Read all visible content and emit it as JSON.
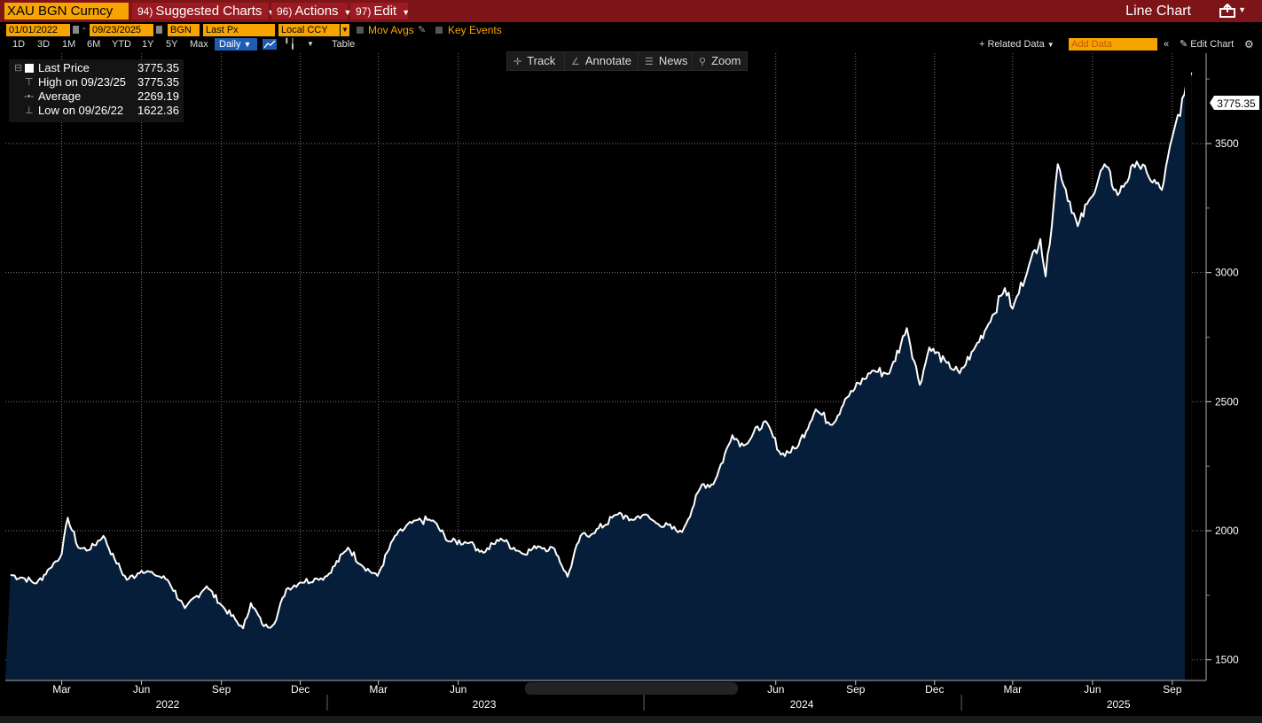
{
  "header": {
    "ticker": "XAU BGN Curncy",
    "menus": [
      {
        "num": "94)",
        "label": "Suggested Charts"
      },
      {
        "num": "96)",
        "label": "Actions"
      },
      {
        "num": "97)",
        "label": "Edit"
      }
    ],
    "chart_type_label": "Line Chart"
  },
  "controls": {
    "start_date": "01/01/2022",
    "end_date": "09/23/2025",
    "source": "BGN",
    "field": "Last Px",
    "currency": "Local CCY",
    "mov_avgs": "Mov Avgs",
    "key_events": "Key Events",
    "ranges": [
      "1D",
      "3D",
      "1M",
      "6M",
      "YTD",
      "1Y",
      "5Y",
      "Max"
    ],
    "frequency": "Daily",
    "table": "Table",
    "related_data": "+ Related Data",
    "add_data_placeholder": "Add Data",
    "edit_chart": "Edit Chart"
  },
  "toolbar": {
    "track": "Track",
    "annotate": "Annotate",
    "news": "News",
    "zoom": "Zoom"
  },
  "legend": {
    "rows": [
      {
        "label": "Last Price",
        "value": "3775.35"
      },
      {
        "label": "High on 09/23/25",
        "value": "3775.35"
      },
      {
        "label": "Average",
        "value": "2269.19"
      },
      {
        "label": "Low on 09/26/22",
        "value": "1622.36"
      }
    ]
  },
  "colors": {
    "accent": "#f7a400",
    "topbar": "#7d1418",
    "area_fill": "#061e3a",
    "line": "#ffffff"
  },
  "chart_data": {
    "type": "area",
    "series": [
      {
        "name": "Last Price",
        "points": [
          [
            "2022-01-01",
            1829
          ],
          [
            "2022-01-15",
            1818
          ],
          [
            "2022-01-31",
            1796
          ],
          [
            "2022-02-15",
            1854
          ],
          [
            "2022-03-01",
            1910
          ],
          [
            "2022-03-08",
            2050
          ],
          [
            "2022-03-20",
            1935
          ],
          [
            "2022-04-01",
            1925
          ],
          [
            "2022-04-18",
            1980
          ],
          [
            "2022-05-01",
            1890
          ],
          [
            "2022-05-15",
            1810
          ],
          [
            "2022-06-01",
            1845
          ],
          [
            "2022-06-15",
            1832
          ],
          [
            "2022-07-01",
            1810
          ],
          [
            "2022-07-21",
            1700
          ],
          [
            "2022-08-15",
            1785
          ],
          [
            "2022-09-01",
            1712
          ],
          [
            "2022-09-26",
            1622
          ],
          [
            "2022-10-05",
            1720
          ],
          [
            "2022-10-20",
            1630
          ],
          [
            "2022-11-01",
            1640
          ],
          [
            "2022-11-15",
            1775
          ],
          [
            "2022-12-01",
            1800
          ],
          [
            "2022-12-20",
            1815
          ],
          [
            "2023-01-01",
            1825
          ],
          [
            "2023-01-25",
            1935
          ],
          [
            "2023-02-10",
            1865
          ],
          [
            "2023-02-28",
            1825
          ],
          [
            "2023-03-20",
            1980
          ],
          [
            "2023-04-13",
            2040
          ],
          [
            "2023-05-03",
            2040
          ],
          [
            "2023-05-20",
            1960
          ],
          [
            "2023-06-15",
            1955
          ],
          [
            "2023-06-30",
            1915
          ],
          [
            "2023-07-20",
            1970
          ],
          [
            "2023-08-15",
            1910
          ],
          [
            "2023-09-01",
            1940
          ],
          [
            "2023-09-20",
            1930
          ],
          [
            "2023-10-05",
            1822
          ],
          [
            "2023-10-20",
            1980
          ],
          [
            "2023-11-01",
            1985
          ],
          [
            "2023-12-04",
            2070
          ],
          [
            "2023-12-15",
            2040
          ],
          [
            "2024-01-01",
            2063
          ],
          [
            "2024-01-15",
            2030
          ],
          [
            "2024-02-14",
            1995
          ],
          [
            "2024-03-08",
            2180
          ],
          [
            "2024-03-21",
            2180
          ],
          [
            "2024-04-12",
            2370
          ],
          [
            "2024-04-25",
            2330
          ],
          [
            "2024-05-20",
            2425
          ],
          [
            "2024-06-07",
            2295
          ],
          [
            "2024-06-25",
            2320
          ],
          [
            "2024-07-17",
            2470
          ],
          [
            "2024-08-05",
            2410
          ],
          [
            "2024-08-20",
            2510
          ],
          [
            "2024-09-20",
            2620
          ],
          [
            "2024-10-10",
            2610
          ],
          [
            "2024-10-30",
            2785
          ],
          [
            "2024-11-14",
            2565
          ],
          [
            "2024-11-25",
            2710
          ],
          [
            "2024-12-15",
            2650
          ],
          [
            "2024-12-30",
            2610
          ],
          [
            "2025-01-15",
            2700
          ],
          [
            "2025-02-01",
            2800
          ],
          [
            "2025-02-20",
            2940
          ],
          [
            "2025-03-01",
            2860
          ],
          [
            "2025-03-20",
            3030
          ],
          [
            "2025-04-02",
            3130
          ],
          [
            "2025-04-08",
            2985
          ],
          [
            "2025-04-22",
            3420
          ],
          [
            "2025-05-15",
            3180
          ],
          [
            "2025-05-30",
            3290
          ],
          [
            "2025-06-15",
            3420
          ],
          [
            "2025-06-30",
            3300
          ],
          [
            "2025-07-22",
            3430
          ],
          [
            "2025-08-05",
            3370
          ],
          [
            "2025-08-20",
            3320
          ],
          [
            "2025-09-05",
            3580
          ],
          [
            "2025-09-15",
            3690
          ],
          [
            "2025-09-23",
            3775.35
          ]
        ]
      }
    ],
    "last_value_label": "3775.35",
    "ylim": [
      1420,
      3850
    ],
    "yticks": [
      1500,
      2000,
      2500,
      3000,
      3500
    ],
    "xlim": [
      "2021-12-26",
      "2025-10-10"
    ],
    "month_ticks": [
      {
        "date": "2022-03-01",
        "label": "Mar"
      },
      {
        "date": "2022-06-01",
        "label": "Jun"
      },
      {
        "date": "2022-09-01",
        "label": "Sep"
      },
      {
        "date": "2022-12-01",
        "label": "Dec"
      },
      {
        "date": "2023-03-01",
        "label": "Mar"
      },
      {
        "date": "2023-06-01",
        "label": "Jun"
      },
      {
        "date": "2024-06-01",
        "label": "Jun"
      },
      {
        "date": "2024-09-01",
        "label": "Sep"
      },
      {
        "date": "2024-12-01",
        "label": "Dec"
      },
      {
        "date": "2025-03-01",
        "label": "Mar"
      },
      {
        "date": "2025-06-01",
        "label": "Jun"
      },
      {
        "date": "2025-09-01",
        "label": "Sep"
      }
    ],
    "year_labels": [
      {
        "date": "2022-07-01",
        "label": "2022"
      },
      {
        "date": "2023-07-01",
        "label": "2023"
      },
      {
        "date": "2024-07-01",
        "label": "2024"
      },
      {
        "date": "2025-07-01",
        "label": "2025"
      }
    ],
    "year_dividers": [
      "2023-01-01",
      "2024-01-01",
      "2025-01-01"
    ],
    "grid": true
  }
}
